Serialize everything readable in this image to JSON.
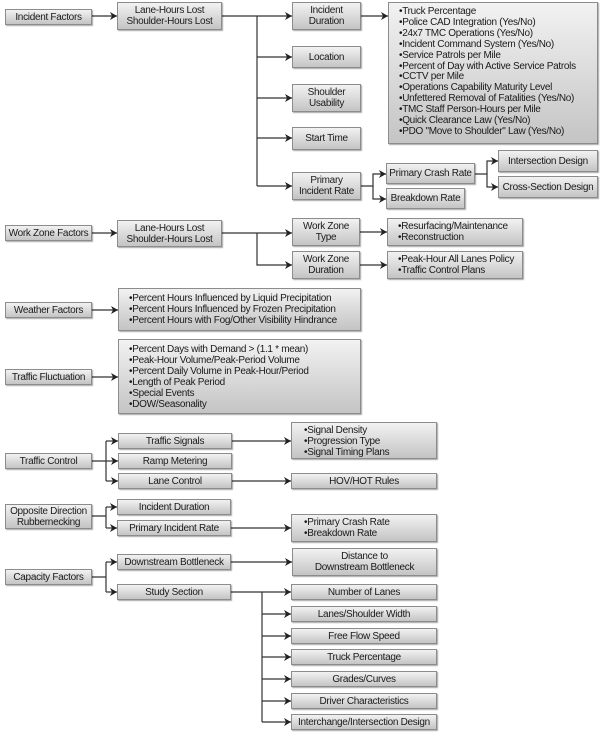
{
  "incident": {
    "root": "Incident Factors",
    "lost": "Lane-Hours Lost\nShoulder-Hours Lost",
    "duration": "Incident\nDuration",
    "duration_factors": [
      "Truck Percentage",
      "Police CAD Integration (Yes/No)",
      "24x7 TMC Operations (Yes/No)",
      "Incident Command System (Yes/No)",
      "Service Patrols per Mile",
      "Percent of Day with  Active Service Patrols",
      "CCTV per Mile",
      "Operations Capability Maturity Level",
      "Unfettered Removal of Fatalities (Yes/No)",
      "TMC Staff Person-Hours per Mile",
      "Quick Clearance Law (Yes/No)",
      "PDO \"Move to Shoulder\" Law (Yes/No)"
    ],
    "location": "Location",
    "shoulder": "Shoulder\nUsability",
    "start_time": "Start Time",
    "primary_rate": "Primary\nIncident Rate",
    "crash_rate": "Primary Crash Rate",
    "breakdown_rate": "Breakdown Rate",
    "intersection_design": "Intersection Design",
    "cross_section_design": "Cross-Section Design"
  },
  "work_zone": {
    "root": "Work Zone Factors",
    "lost": "Lane-Hours Lost\nShoulder-Hours Lost",
    "type": "Work Zone\nType",
    "type_factors": [
      "Resurfacing/Maintenance",
      "Reconstruction"
    ],
    "duration": "Work Zone\nDuration",
    "duration_factors": [
      "Peak-Hour All Lanes Policy",
      "Traffic Control Plans"
    ]
  },
  "weather": {
    "root": "Weather Factors",
    "factors": [
      "Percent Hours Influenced by Liquid Precipitation",
      "Percent Hours Influenced by Frozen Precipitation",
      "Percent Hours with Fog/Other Visibility Hindrance"
    ]
  },
  "fluctuation": {
    "root": "Traffic Fluctuation",
    "factors": [
      "Percent Days with Demand > (1.1 * mean)",
      "Peak-Hour Volume/Peak-Period Volume",
      "Percent Daily Volume in Peak-Hour/Period",
      "Length of Peak Period",
      "Special Events",
      "DOW/Seasonality"
    ]
  },
  "traffic_control": {
    "root": "Traffic Control",
    "signals": "Traffic Signals",
    "signal_factors": [
      "Signal Density",
      "Progression Type",
      "Signal Timing Plans"
    ],
    "ramp": "Ramp Metering",
    "lane": "Lane Control",
    "hov": "HOV/HOT Rules"
  },
  "opposite": {
    "root": "Opposite Direction\nRubbernecking",
    "duration": "Incident Duration",
    "rate": "Primary Incident Rate",
    "rate_factors": [
      "Primary Crash Rate",
      "Breakdown Rate"
    ]
  },
  "capacity": {
    "root": "Capacity Factors",
    "downstream": "Downstream Bottleneck",
    "distance": "Distance to\nDownstream Bottleneck",
    "study": "Study Section",
    "study_factors": [
      "Number of Lanes",
      "Lanes/Shoulder Width",
      "Free Flow Speed",
      "Truck Percentage",
      "Grades/Curves",
      "Driver Characteristics",
      "Interchange/Intersection Design"
    ]
  }
}
